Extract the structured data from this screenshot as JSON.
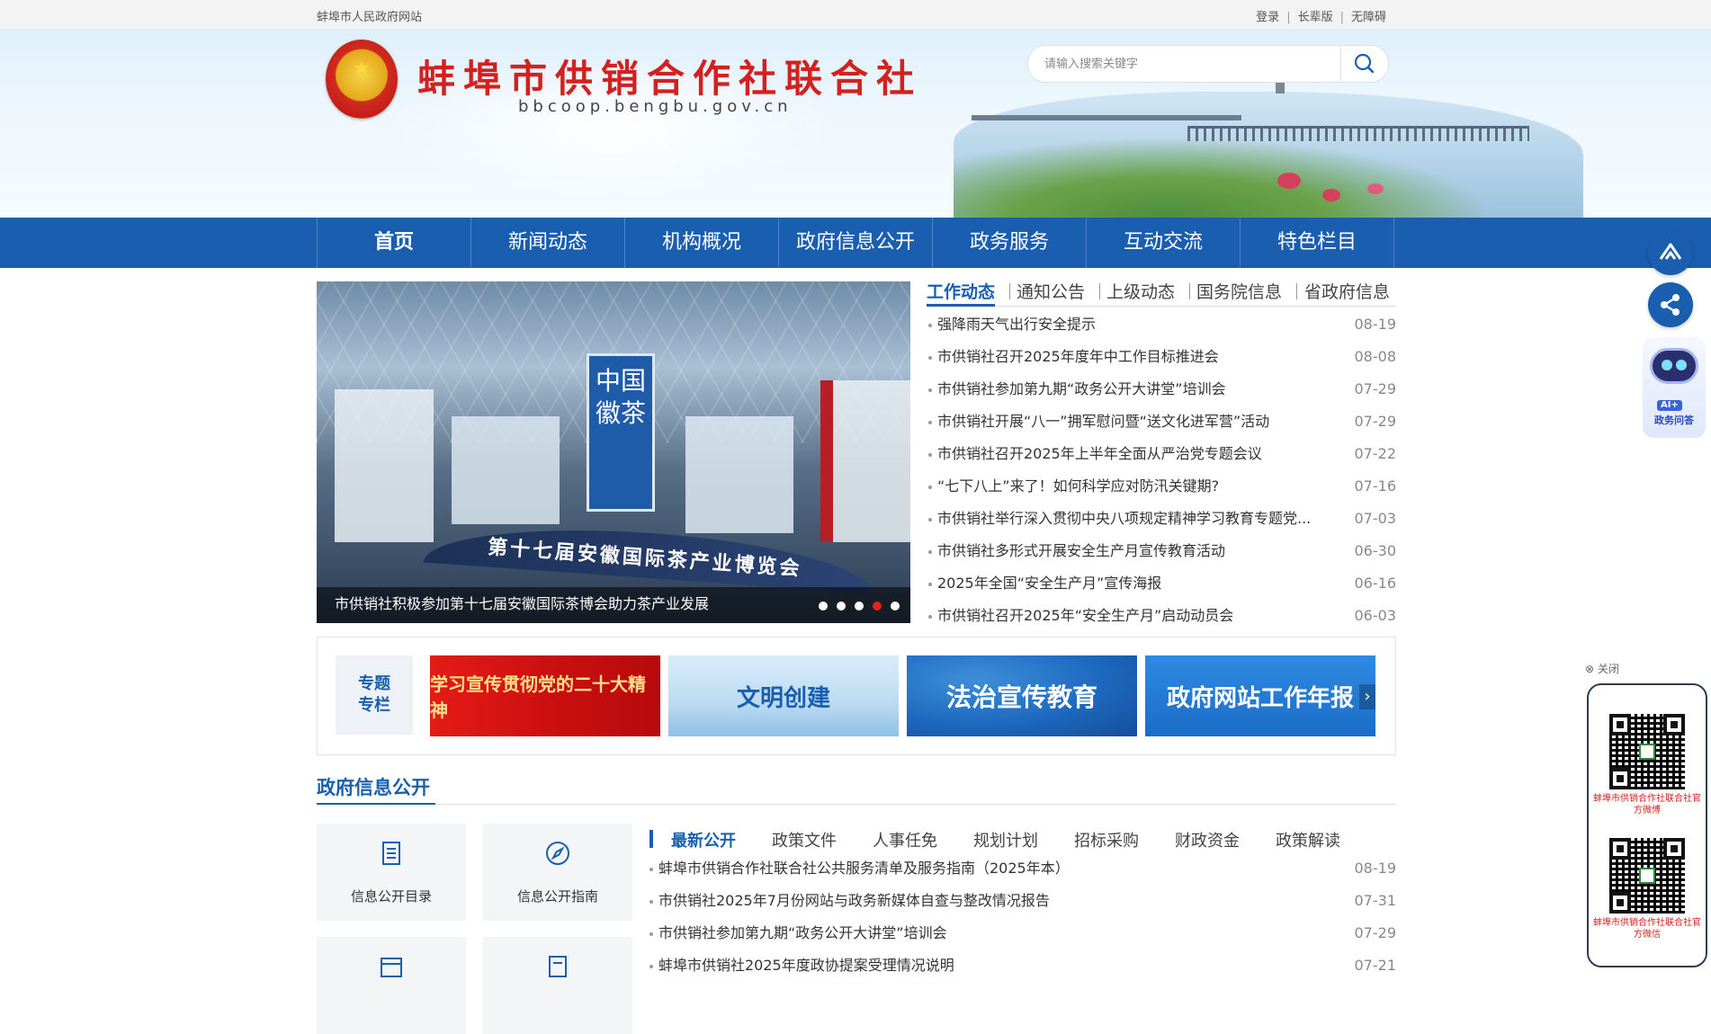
{
  "topbar": {
    "site_name": "蚌埠市人民政府网站",
    "links": [
      "登录",
      "长辈版",
      "无障碍"
    ]
  },
  "header": {
    "title": "蚌埠市供销合作社联合社",
    "url": "bbcoop.bengbu.gov.cn",
    "search_placeholder": "请输入搜索关键字"
  },
  "nav": {
    "items": [
      "首页",
      "新闻动态",
      "机构概况",
      "政府信息公开",
      "政务服务",
      "互动交流",
      "特色栏目"
    ],
    "active": "首页"
  },
  "carousel": {
    "sign_text": "中国徽茶",
    "arc_text": "第十七届安徽国际茶产业博览会",
    "caption": "市供销社积极参加第十七届安徽国际茶博会助力茶产业发展",
    "slide_count": 5,
    "active_index": 3
  },
  "news": {
    "tabs": [
      "工作动态",
      "通知公告",
      "上级动态",
      "国务院信息",
      "省政府信息"
    ],
    "active_tab": "工作动态",
    "items": [
      {
        "title": "强降雨天气出行安全提示",
        "date": "08-19"
      },
      {
        "title": "市供销社召开2025年度年中工作目标推进会",
        "date": "08-08"
      },
      {
        "title": "市供销社参加第九期“政务公开大讲堂”培训会",
        "date": "07-29"
      },
      {
        "title": "市供销社开展“八一”拥军慰问暨“送文化进军营”活动",
        "date": "07-29"
      },
      {
        "title": "市供销社召开2025年上半年全面从严治党专题会议",
        "date": "07-22"
      },
      {
        "title": "“七下八上”来了！如何科学应对防汛关键期?",
        "date": "07-16"
      },
      {
        "title": "市供销社举行深入贯彻中央八项规定精神学习教育专题党...",
        "date": "07-03"
      },
      {
        "title": "市供销社多形式开展安全生产月宣传教育活动",
        "date": "06-30"
      },
      {
        "title": "2025年全国“安全生产月”宣传海报",
        "date": "06-16"
      },
      {
        "title": "市供销社召开2025年“安全生产月”启动动员会",
        "date": "06-03"
      }
    ]
  },
  "topics": {
    "label_line1": "专题",
    "label_line2": "专栏",
    "cards": [
      "学习宣传贯彻党的二十大精神",
      "文明创建",
      "法治宣传教育",
      "政府网站工作年报"
    ],
    "next_arrow": "›"
  },
  "gov_info": {
    "title": "政府信息公开",
    "quick_links": [
      "信息公开目录",
      "信息公开指南"
    ],
    "tabs": [
      "最新公开",
      "政策文件",
      "人事任免",
      "规划计划",
      "招标采购",
      "财政资金",
      "政策解读"
    ],
    "active_tab": "最新公开",
    "items": [
      {
        "title": "蚌埠市供销合作社联合社公共服务清单及服务指南（2025年本）",
        "date": "08-19"
      },
      {
        "title": "市供销社2025年7月份网站与政务新媒体自查与整改情况报告",
        "date": "07-31"
      },
      {
        "title": "市供销社参加第九期“政务公开大讲堂”培训会",
        "date": "07-29"
      },
      {
        "title": "蚌埠市供销社2025年度政协提案受理情况说明",
        "date": "07-21"
      }
    ]
  },
  "side": {
    "ai_badge": "AI+",
    "ai_label": "政务问答",
    "close_label": "⊗ 关闭",
    "qr_captions": [
      "蚌埠市供销合作社联合社官方微博",
      "蚌埠市供销合作社联合社官方微信"
    ]
  },
  "colors": {
    "primary": "#1a5faf",
    "title_red": "#d3211f",
    "active_dot": "#e2231a"
  }
}
